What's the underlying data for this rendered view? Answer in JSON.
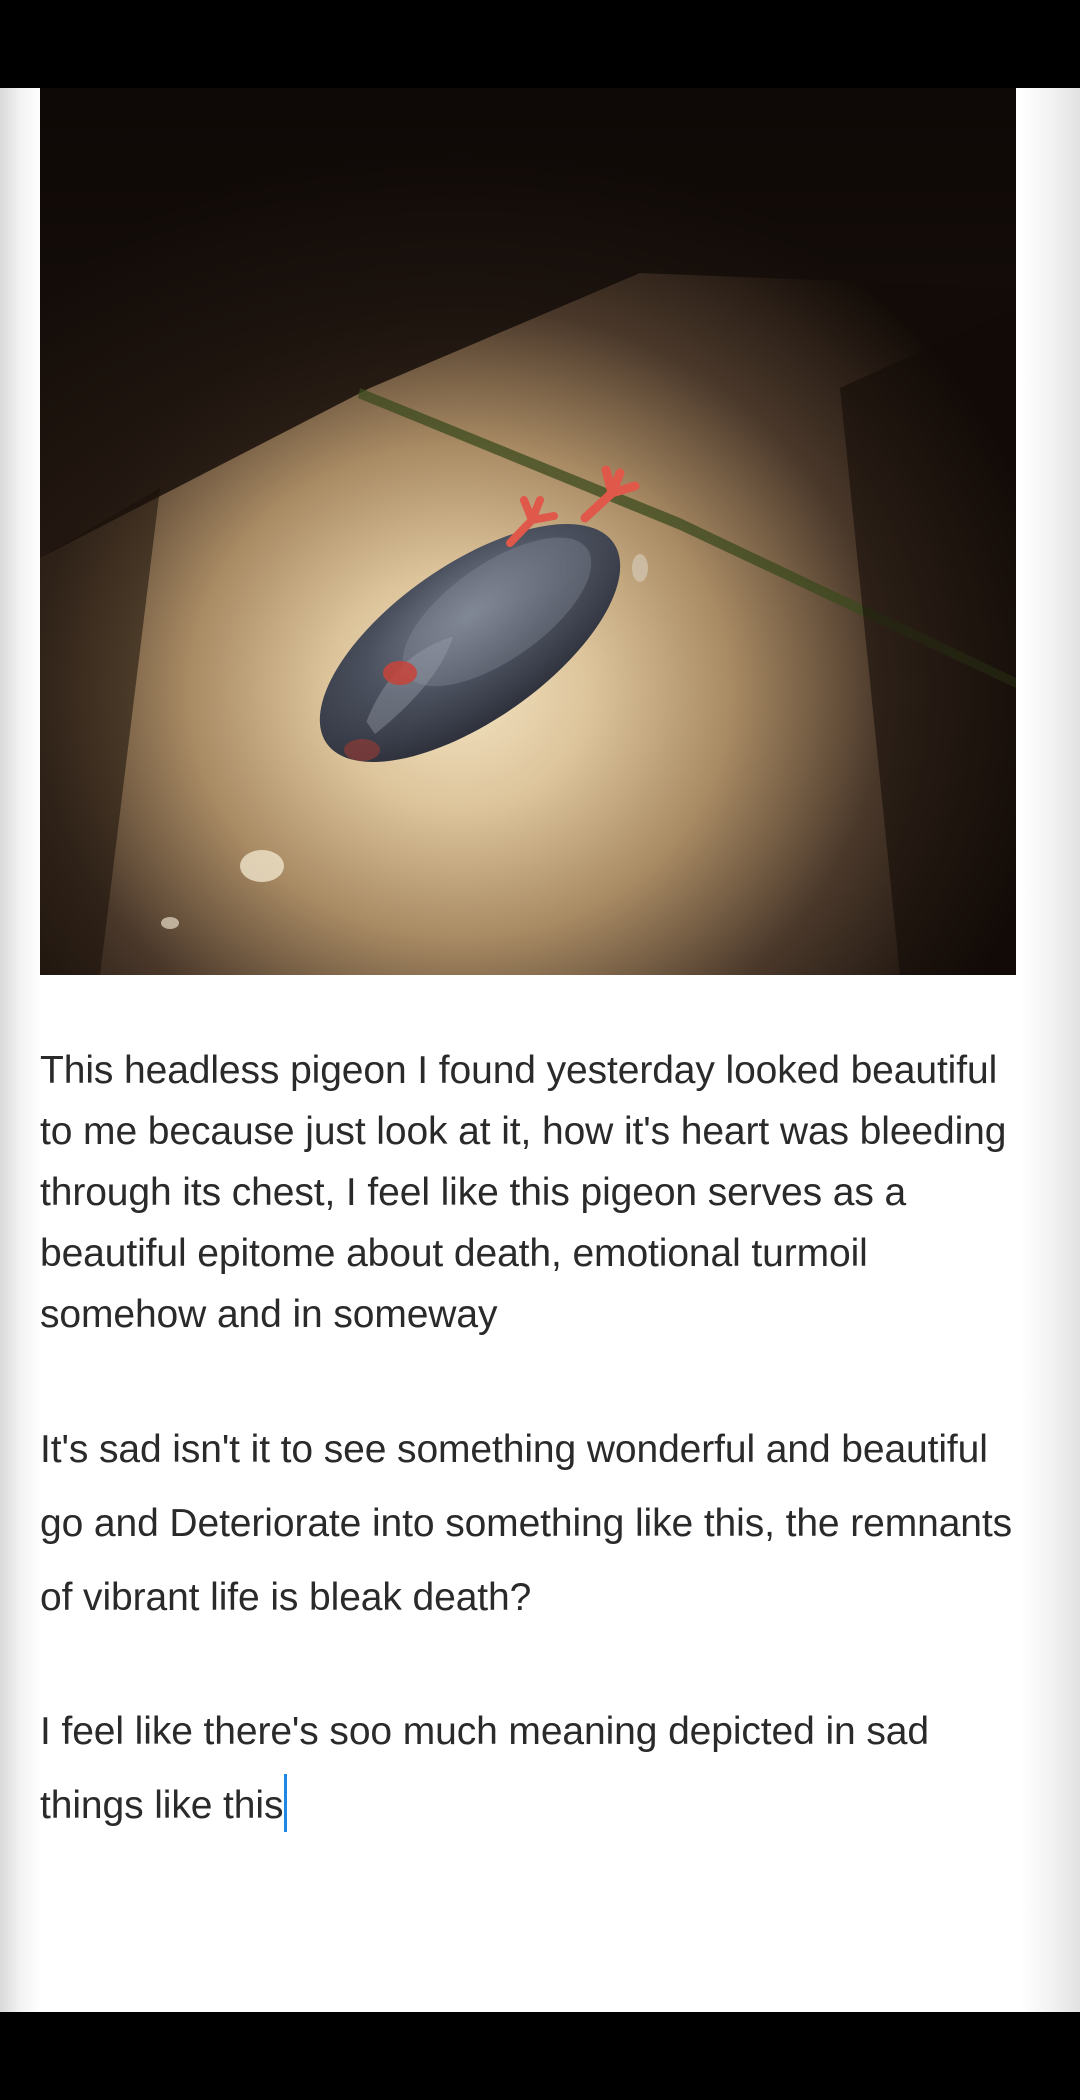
{
  "post": {
    "image_alt": "",
    "paragraphs": [
      "This headless pigeon I found yesterday looked beautiful to me because just look at it, how it's heart was bleeding through its chest, I feel like this pigeon serves as a beautiful epitome about death, emotional turmoil somehow and in someway",
      "It's sad isn't it to see something wonderful and beautiful go and Deteriorate into something like this, the remnants of vibrant life is bleak death?",
      "I feel like there's soo much meaning depicted in sad things like this"
    ]
  },
  "colors": {
    "caret": "#1e88e5",
    "text": "#2a2a2a",
    "background": "#ffffff"
  }
}
